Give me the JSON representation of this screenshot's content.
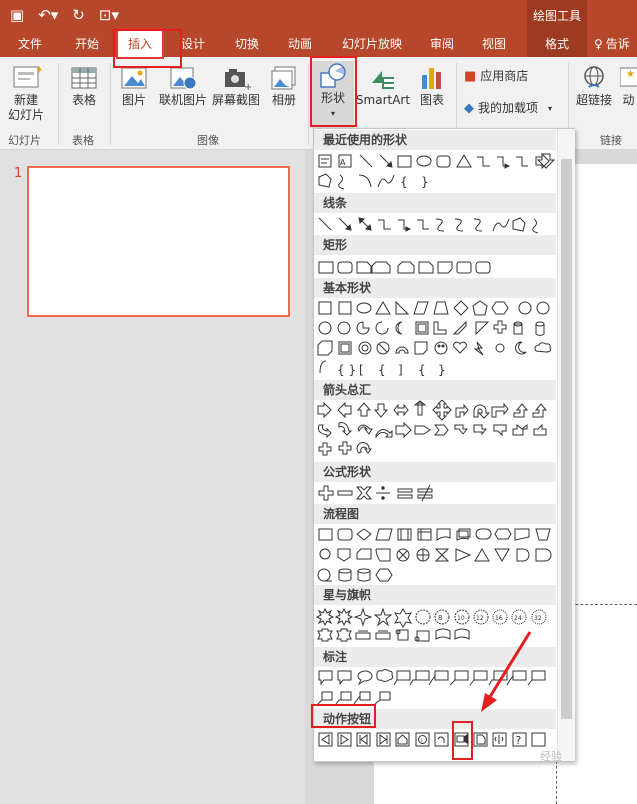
{
  "quick_access": {
    "save_icon": "save-icon",
    "undo_icon": "undo-icon",
    "redo_icon": "redo-icon",
    "present_icon": "present-icon"
  },
  "context_title": "绘图工具",
  "tabs": [
    "文件",
    "开始",
    "插入",
    "设计",
    "切换",
    "动画",
    "幻灯片放映",
    "审阅",
    "视图",
    "格式",
    "告诉"
  ],
  "active_tab": "插入",
  "ribbon": {
    "new_slide": "新建\n幻灯片",
    "table": "表格",
    "picture": "图片",
    "online_picture": "联机图片",
    "screenshot": "屏幕截图",
    "album": "相册",
    "shapes": "形状",
    "smartart": "SmartArt",
    "chart": "图表",
    "store": "应用商店",
    "my_addins": "我的加载项",
    "hyperlink": "超链接",
    "action": "动",
    "groups": {
      "slides": "幻灯片",
      "tables": "表格",
      "images": "图像",
      "links": "链接"
    }
  },
  "slide_number": "1",
  "gallery_sections": [
    "最近使用的形状",
    "线条",
    "矩形",
    "基本形状",
    "箭头总汇",
    "公式形状",
    "流程图",
    "星与旗帜",
    "标注",
    "动作按钮"
  ],
  "watermark": "经验",
  "accent_color": "#b7472a",
  "highlight_color": "#e3201f"
}
